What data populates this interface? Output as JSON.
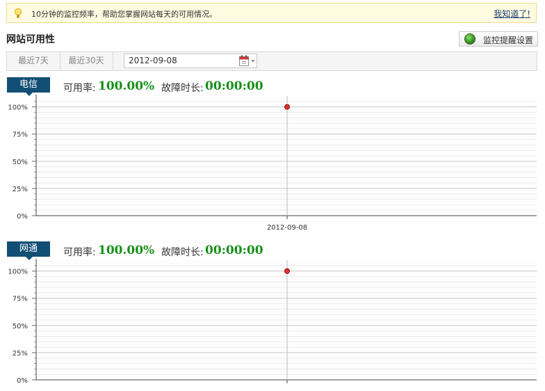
{
  "notice": {
    "message": "10分钟的监控频率，帮助您掌握网站每天的可用情况。",
    "dismiss_label": "我知道了!",
    "icon": "lightbulb-icon"
  },
  "section": {
    "title": "网站可用性",
    "remind_label": "监控提醒设置",
    "remind_icon": "status-dot-icon"
  },
  "toolbar": {
    "tabs": [
      "最近7天",
      "最近30天"
    ],
    "date_value": "2012-09-08",
    "calendar_icon": "calendar-icon"
  },
  "colors": {
    "tag_bg": "#134f74",
    "value_green": "#169018",
    "point_red": "#e03030"
  },
  "panels": [
    {
      "isp": "电信",
      "availability_label": "可用率:",
      "availability_value": "100.00%",
      "downtime_label": "故障时长:",
      "downtime_value": "00:00:00"
    },
    {
      "isp": "网通",
      "availability_label": "可用率:",
      "availability_value": "100.00%",
      "downtime_label": "故障时长:",
      "downtime_value": "00:00:00"
    }
  ],
  "chart_data": [
    {
      "type": "scatter",
      "series": [
        {
          "x": [
            "2012-09-08"
          ],
          "values": [
            100
          ]
        }
      ],
      "y_ticks": [
        "0%",
        "25%",
        "50%",
        "75%",
        "100%"
      ],
      "x_ticks": [
        "2012-09-08"
      ],
      "ylim": [
        0,
        110
      ],
      "grid": true
    },
    {
      "type": "scatter",
      "series": [
        {
          "x": [
            "2012-09-08"
          ],
          "values": [
            100
          ]
        }
      ],
      "y_ticks": [
        "0%",
        "25%",
        "50%",
        "75%",
        "100%"
      ],
      "x_ticks": [],
      "ylim": [
        0,
        110
      ],
      "grid": true
    }
  ]
}
